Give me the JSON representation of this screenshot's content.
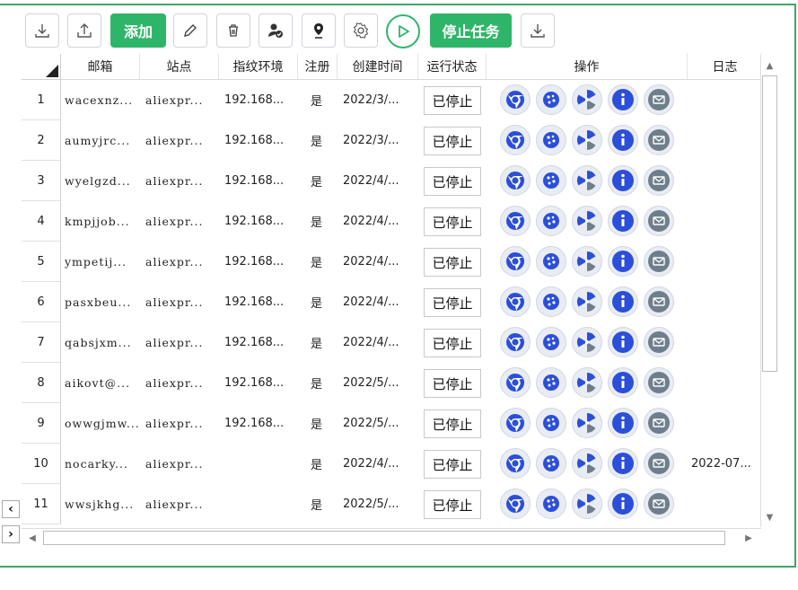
{
  "toolbar": {
    "add_label": "添加",
    "stop_label": "停止任务"
  },
  "columns": [
    "邮箱",
    "站点",
    "指纹环境",
    "注册",
    "创建时间",
    "运行状态",
    "操作",
    "日志"
  ],
  "rows": [
    {
      "num": "1",
      "email": "wacexnz...",
      "site": "aliexpr...",
      "env": "192.168...",
      "reg": "是",
      "time": "2022/3/...",
      "status": "已停止",
      "log": ""
    },
    {
      "num": "2",
      "email": "aumyjrc...",
      "site": "aliexpr...",
      "env": "192.168...",
      "reg": "是",
      "time": "2022/3/...",
      "status": "已停止",
      "log": ""
    },
    {
      "num": "3",
      "email": "wyelgzd...",
      "site": "aliexpr...",
      "env": "192.168...",
      "reg": "是",
      "time": "2022/4/...",
      "status": "已停止",
      "log": ""
    },
    {
      "num": "4",
      "email": "kmpjjob...",
      "site": "aliexpr...",
      "env": "192.168...",
      "reg": "是",
      "time": "2022/4/...",
      "status": "已停止",
      "log": ""
    },
    {
      "num": "5",
      "email": "ympetij...",
      "site": "aliexpr...",
      "env": "192.168...",
      "reg": "是",
      "time": "2022/4/...",
      "status": "已停止",
      "log": ""
    },
    {
      "num": "6",
      "email": "pasxbeu...",
      "site": "aliexpr...",
      "env": "192.168...",
      "reg": "是",
      "time": "2022/4/...",
      "status": "已停止",
      "log": ""
    },
    {
      "num": "7",
      "email": "qabsjxm...",
      "site": "aliexpr...",
      "env": "192.168...",
      "reg": "是",
      "time": "2022/4/...",
      "status": "已停止",
      "log": ""
    },
    {
      "num": "8",
      "email": "aikovt@...",
      "site": "aliexpr...",
      "env": "192.168...",
      "reg": "是",
      "time": "2022/5/...",
      "status": "已停止",
      "log": ""
    },
    {
      "num": "9",
      "email": "owwgjmw...",
      "site": "aliexpr...",
      "env": "192.168...",
      "reg": "是",
      "time": "2022/5/...",
      "status": "已停止",
      "log": ""
    },
    {
      "num": "10",
      "email": "nocarky...",
      "site": "aliexpr...",
      "env": "",
      "reg": "是",
      "time": "2022/4/...",
      "status": "已停止",
      "log": "2022-07..."
    },
    {
      "num": "11",
      "email": "wwsjkhg...",
      "site": "aliexpr...",
      "env": "",
      "reg": "是",
      "time": "2022/5/...",
      "status": "已停止",
      "log": ""
    }
  ],
  "colors": {
    "accent": "#2fb569",
    "icon_blue": "#2b4fd8",
    "icon_gray": "#6f7e8c"
  },
  "icons": [
    "chrome-icon",
    "cookie-icon",
    "fan-icon",
    "info-icon",
    "mail-icon"
  ]
}
